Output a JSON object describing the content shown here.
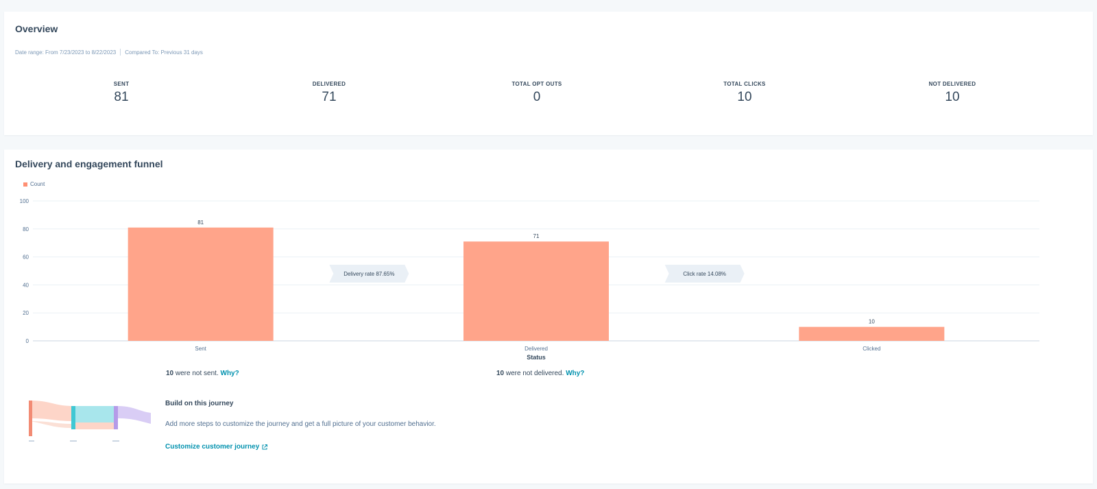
{
  "overview": {
    "title": "Overview",
    "date_range": "Date range: From 7/23/2023 to 8/22/2023",
    "compared_to": "Compared To: Previous 31 days",
    "metrics": [
      {
        "label": "SENT",
        "value": "81"
      },
      {
        "label": "DELIVERED",
        "value": "71"
      },
      {
        "label": "TOTAL OPT OUTS",
        "value": "0"
      },
      {
        "label": "TOTAL CLICKS",
        "value": "10"
      },
      {
        "label": "NOT DELIVERED",
        "value": "10"
      }
    ]
  },
  "funnel": {
    "title": "Delivery and engagement funnel",
    "notes": {
      "not_sent_count": "10",
      "not_sent_text": " were not sent. ",
      "not_delivered_count": "10",
      "not_delivered_text": " were not delivered. ",
      "why_label": "Why?"
    },
    "journey": {
      "title": "Build on this journey",
      "description": "Add more steps to customize the journey and get a full picture of your customer behavior.",
      "link_label": "Customize customer journey",
      "link_icon": "external-link-icon"
    }
  },
  "chart_data": {
    "type": "bar",
    "categories": [
      "Sent",
      "Delivered",
      "Clicked"
    ],
    "series": [
      {
        "name": "Count",
        "values": [
          81,
          71,
          10
        ],
        "color": "#ffa48a"
      }
    ],
    "value_labels": [
      "81",
      "71",
      "10"
    ],
    "xlabel": "Status",
    "ylabel": "",
    "ylim": [
      0,
      100
    ],
    "yticks": [
      0,
      20,
      40,
      60,
      80,
      100
    ],
    "grid": true,
    "legend": "top-left",
    "annotations": [
      "Delivery rate 87.65%",
      "Click rate 14.08%"
    ]
  }
}
